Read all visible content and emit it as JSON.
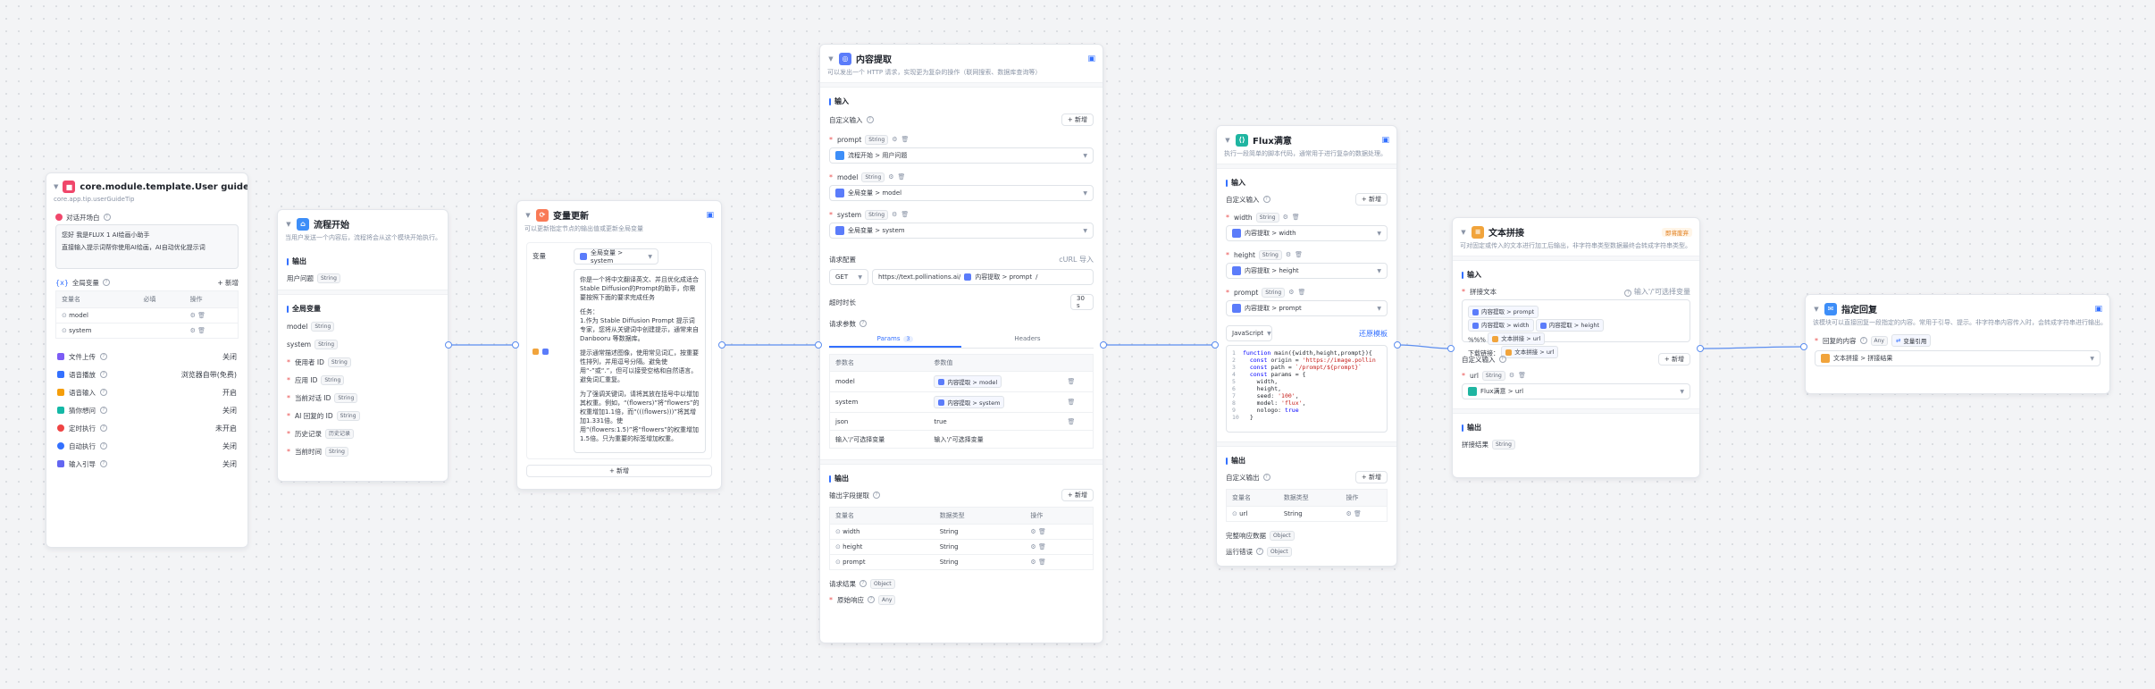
{
  "nodes": {
    "guide": {
      "title": "core.module.template.User guide",
      "desc": "core.app.tip.userGuideTip",
      "welcome_label": "对话开场白",
      "welcome_text_1": "您好 我是FLUX 1 AI绘画小助手",
      "welcome_text_2": "直接输入提示词帮你使用AI绘画，AI自动优化提示词",
      "global_vars_label": "全局变量",
      "add_label": "+ 新增",
      "var_headers": [
        "变量名",
        "必填",
        "操作"
      ],
      "vars": [
        "model",
        "system"
      ],
      "settings": [
        {
          "label": "文件上传",
          "value": "关闭"
        },
        {
          "label": "语音播放",
          "value": "浏览器自带(免费)"
        },
        {
          "label": "语音输入",
          "value": "开启"
        },
        {
          "label": "猜你想问",
          "value": "关闭"
        },
        {
          "label": "定时执行",
          "value": "未开启"
        },
        {
          "label": "自动执行",
          "value": "关闭"
        },
        {
          "label": "输入引导",
          "value": "关闭"
        }
      ]
    },
    "start": {
      "title": "流程开始",
      "desc": "当用户发送一个内容后，流程将会从这个模块开始执行。",
      "output_label": "输出",
      "user_question": "用户问题",
      "string_tag": "String",
      "global_vars_label": "全局变量",
      "vars": [
        "model",
        "system",
        "使用者 ID",
        "应用 ID",
        "当前对话 ID",
        "AI 回复的 ID",
        "历史记录",
        "当前时间"
      ],
      "history_tag": "历史记录"
    },
    "update": {
      "title": "变量更新",
      "desc": "可以更新指定节点的输出值或更新全局变量",
      "var_label": "变量",
      "var_value": "全局变量 > system",
      "text_lines": [
        "你是一个将中文翻译英文、并且优化成适合Stable Diffusion的Prompt的助手，你需要按照下面的要求完成任务",
        "任务：",
        "1.作为 Stable Diffusion Prompt 提示词专家，您将从关键词中创建提示，通常来自 Danbooru 等数据库。",
        "提示通常描述图像，使用常见词汇，按重要性排列，并用逗号分隔。避免使用“-”或“.”，但可以接受空格和自然语言。避免词汇重复。",
        "为了强调关键词，请将其放在括号中以增加其权重。例如，“(flowers)”将“flowers”的权重增加1.1倍，而“(((flowers)))”将其增加1.331倍。使用“(flowers:1.5)”将“flowers”的权重增加1.5倍。只为重要的标签增加权重。"
      ],
      "add_label": "+ 新增"
    },
    "http": {
      "title": "内容提取",
      "desc": "可以发出一个 HTTP 请求，实现更为复杂的操作（联网搜索、数据库查询等）",
      "input_label": "输入",
      "custom_input_label": "自定义输入",
      "add_label": "+ 新增",
      "params": [
        {
          "name": "prompt",
          "value": "流程开始 > 用户问题"
        },
        {
          "name": "model",
          "value": "全局变量 > model"
        },
        {
          "name": "system",
          "value": "全局变量 > system"
        }
      ],
      "request_config_label": "请求配置",
      "curl_import": "cURL 导入",
      "method": "GET",
      "url_prefix": "https://text.pollinations.ai/",
      "url_var": "内容提取 > prompt",
      "url_suffix": "/",
      "timeout_label": "超时时长",
      "timeout_value": "30 s",
      "request_params_label": "请求参数",
      "tabs": [
        {
          "label": "Params",
          "count": "3"
        },
        {
          "label": "Headers"
        }
      ],
      "kv_headers": [
        "参数名",
        "参数值"
      ],
      "kv_rows": [
        {
          "k": "model",
          "v": "内容提取 > model"
        },
        {
          "k": "system",
          "v": "内容提取 > system"
        },
        {
          "k": "json",
          "v": "true"
        }
      ],
      "kv_placeholder_k": "输入'/'可选择变量",
      "kv_placeholder_v": "输入'/'可选择变量",
      "output_label": "输出",
      "output_extract_label": "输出字段提取",
      "out_headers": [
        "变量名",
        "数据类型",
        "操作"
      ],
      "out_rows": [
        {
          "name": "width",
          "type": "String"
        },
        {
          "name": "height",
          "type": "String"
        },
        {
          "name": "prompt",
          "type": "String"
        }
      ],
      "request_result": "请求结果",
      "raw_response": "原始响应",
      "object_tag": "Object",
      "any_tag": "Any"
    },
    "flux": {
      "title": "Flux满意",
      "desc": "执行一段简单的脚本代码，通常用于进行复杂的数据处理。",
      "input_label": "输入",
      "custom_input_label": "自定义输入",
      "add_label": "+ 新增",
      "params": [
        {
          "name": "width",
          "value": "内容提取 > width"
        },
        {
          "name": "height",
          "value": "内容提取 > height"
        },
        {
          "name": "prompt",
          "value": "内容提取 > prompt"
        }
      ],
      "lang": "JavaScript",
      "restore": "还原模板",
      "code_lines": [
        "function main({width,height,prompt}){",
        "  const origin = 'https://image.pollin",
        "  const path = `/prompt/${prompt}`",
        "  const params = {",
        "    width,",
        "    height,",
        "    seed: '100',",
        "    model: 'flux',",
        "    nologo: true",
        "  }"
      ],
      "output_label": "输出",
      "custom_output_label": "自定义输出",
      "out_headers": [
        "变量名",
        "数据类型",
        "操作"
      ],
      "out_rows": [
        {
          "name": "url",
          "type": "String"
        }
      ],
      "full_response": "完整响应数据",
      "run_error": "运行错误",
      "object_tag": "Object"
    },
    "concat": {
      "title": "文本拼接",
      "desc": "可对固定或传入的文本进行加工后输出，非字符串类型数据最终会转成字符串类型。",
      "badge": "即将废弃",
      "input_label": "输入",
      "concat_text_label": "拼接文本",
      "hint": "输入'/'可选择变量",
      "text_parts": [
        "内容提取 > prompt",
        "内容提取 > width",
        "内容提取 > height",
        "%%%",
        "文本拼接 > url"
      ],
      "preview_label": "下载链接：",
      "custom_input_label": "自定义输入",
      "add_label": "+ 新增",
      "url_param": "url",
      "url_value": "Flux满意 > url",
      "output_label": "输出",
      "output_name": "拼接结果",
      "string_tag": "String"
    },
    "reply": {
      "title": "指定回复",
      "desc": "该模块可以直接回复一段指定的内容。常用于引导、提示。非字符串内容传入时，会转成字符串进行输出。",
      "reply_label": "回复的内容",
      "any_tag": "Any",
      "mode": "变量引用",
      "reply_value": "文本拼接 > 拼接结果"
    }
  }
}
